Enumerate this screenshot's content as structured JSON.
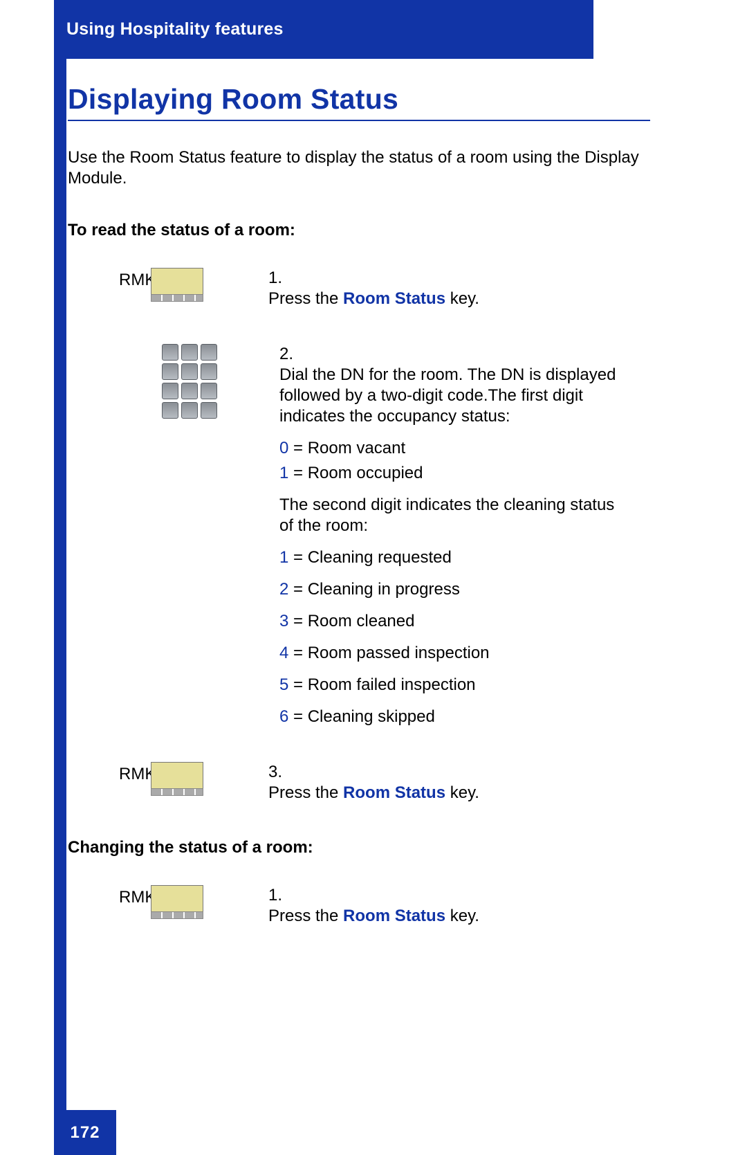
{
  "header": {
    "section": "Using Hospitality features"
  },
  "page_number": "172",
  "title": "Displaying Room Status",
  "intro": "Use the Room Status feature to display the status of a room using the Display Module.",
  "section_read": {
    "heading": "To read the status of a room:"
  },
  "section_change": {
    "heading": "Changing the status of a room:"
  },
  "labels": {
    "rmk": "RMK"
  },
  "steps_read": {
    "s1": {
      "num": "1.",
      "pre": "Press the ",
      "kw": "Room Status",
      "post": " key."
    },
    "s2": {
      "num": "2.",
      "para1": "Dial the DN for the room. The DN is displayed followed by a two-digit code.The first digit indicates the occupancy status:",
      "occ0d": "0",
      "occ0t": " = Room vacant",
      "occ1d": "1",
      "occ1t": " = Room occupied",
      "para2": "The second digit indicates the cleaning status of the room:",
      "c1d": "1",
      "c1t": " = Cleaning requested",
      "c2d": "2",
      "c2t": " = Cleaning in progress",
      "c3d": "3",
      "c3t": " = Room cleaned",
      "c4d": "4",
      "c4t": " = Room passed inspection",
      "c5d": "5",
      "c5t": " = Room failed inspection",
      "c6d": "6",
      "c6t": " = Cleaning skipped"
    },
    "s3": {
      "num": "3.",
      "pre": "Press the ",
      "kw": "Room Status",
      "post": " key."
    }
  },
  "steps_change": {
    "s1": {
      "num": "1.",
      "pre": "Press the ",
      "kw": "Room Status",
      "post": " key."
    }
  }
}
